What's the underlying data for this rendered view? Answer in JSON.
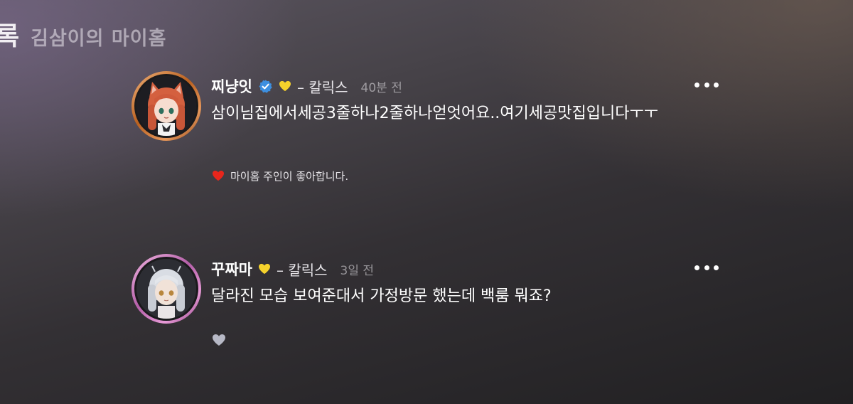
{
  "header": {
    "cut_text": "록",
    "title": "김삼이의 마이홈"
  },
  "comments": [
    {
      "nickname": "찌냥잇",
      "verified": true,
      "rank": "– 칼릭스",
      "time": "40분 전",
      "text": "삼이님집에서세공3줄하나2줄하나얻엇어요..여기세공맛집입니다ㅜㅜ",
      "liked_label": "마이홈 주인이 좋아합니다.",
      "ring_color": "#c8702c",
      "badge_color": "#f5d22c"
    },
    {
      "nickname": "꾸짜마",
      "verified": false,
      "rank": "– 칼릭스",
      "time": "3일 전",
      "text": "달라진 모습 보여준대서 가정방문 했는데 백룸 뭐죠?",
      "liked_label": "",
      "ring_color": "#c46bb5",
      "badge_color": "#f5d22c"
    }
  ],
  "icons": {
    "verified": "verified-check-icon",
    "badge": "yellow-heart-icon",
    "liked": "red-heart-icon",
    "like": "gray-heart-icon",
    "more": "more-dots-icon"
  },
  "colors": {
    "liked_heart": "#e8261c",
    "verified_blue": "#3d8fe0",
    "like_gray": "#b7b9c6"
  }
}
